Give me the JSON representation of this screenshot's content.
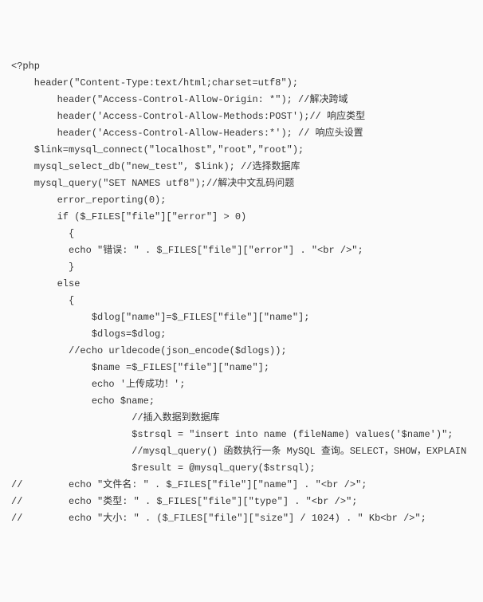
{
  "lines": [
    "<?php",
    "    header(\"Content-Type:text/html;charset=utf8\");",
    "        header(\"Access-Control-Allow-Origin: *\"); //解决跨域",
    "        header('Access-Control-Allow-Methods:POST');// 响应类型",
    "        header('Access-Control-Allow-Headers:*'); // 响应头设置",
    "    $link=mysql_connect(\"localhost\",\"root\",\"root\");",
    "    mysql_select_db(\"new_test\", $link); //选择数据库",
    "    mysql_query(\"SET NAMES utf8\");//解决中文乱码问题",
    "        error_reporting(0);",
    "        if ($_FILES[\"file\"][\"error\"] > 0)",
    "          {",
    "          echo \"错误: \" . $_FILES[\"file\"][\"error\"] . \"<br />\";",
    "          }",
    "        else",
    "          {",
    "              $dlog[\"name\"]=$_FILES[\"file\"][\"name\"];",
    "              $dlogs=$dlog;",
    "          //echo urldecode(json_encode($dlogs));",
    "              $name =$_FILES[\"file\"][\"name\"];",
    "              echo '上传成功！';",
    "              echo $name;",
    "                     //插入数据到数据库",
    "                     $strsql = \"insert into name (fileName) values('$name')\";",
    "                     //mysql_query() 函数执行一条 MySQL 查询。SELECT，SHOW，EXPLAIN",
    "                     $result = @mysql_query($strsql);",
    "//        echo \"文件名: \" . $_FILES[\"file\"][\"name\"] . \"<br />\";",
    "//        echo \"类型: \" . $_FILES[\"file\"][\"type\"] . \"<br />\";",
    "//        echo \"大小: \" . ($_FILES[\"file\"][\"size\"] / 1024) . \" Kb<br />\";"
  ]
}
